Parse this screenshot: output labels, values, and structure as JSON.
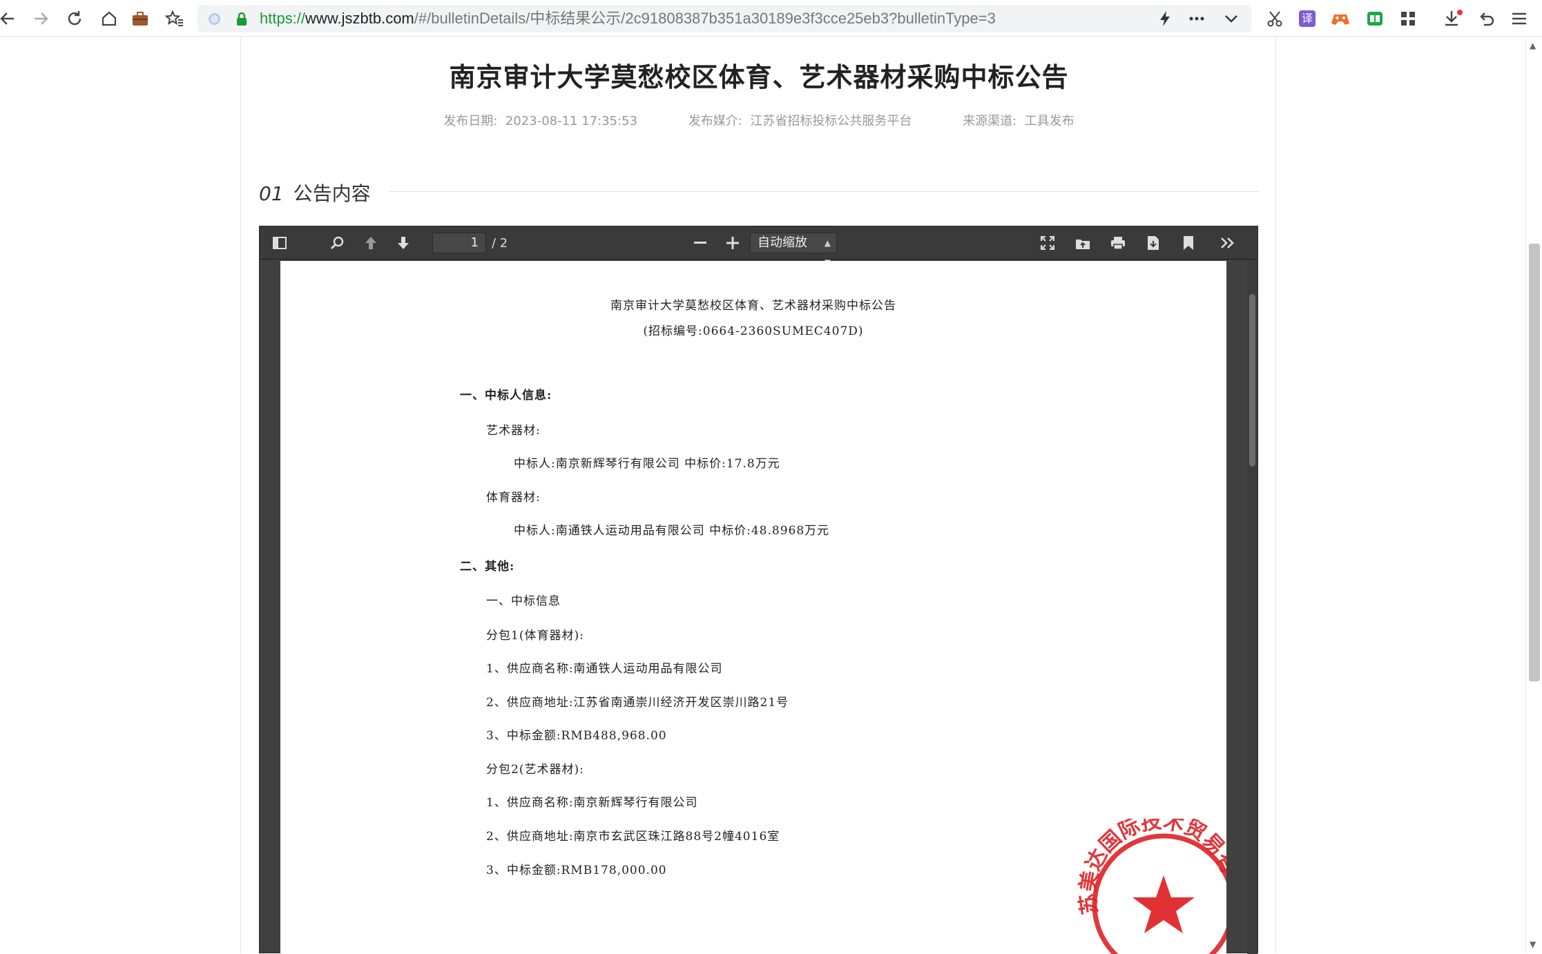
{
  "browser": {
    "url_protocol": "https://",
    "url_host": "www.jszbtb.com",
    "url_rest": "/#/bulletinDetails/中标结果公示/2c91808387b351a30189e3f3cce25eb3?bulletinType=3",
    "icons": [
      "back-icon",
      "forward-icon",
      "reload-icon",
      "home-icon",
      "briefcase-icon",
      "favorites-icon",
      "lightning-icon",
      "more-icon",
      "chevron-down-icon",
      "scissors-icon",
      "translate-icon",
      "gamepad-icon",
      "reader-icon",
      "apps-icon",
      "download-icon",
      "undo-icon",
      "menu-icon"
    ],
    "translate_glyph": "译",
    "accent": "#1a9a35"
  },
  "article": {
    "title": "南京审计大学莫愁校区体育、艺术器材采购中标公告",
    "publish_date_label": "发布日期:",
    "publish_date": "2023-08-11 17:35:53",
    "media_label": "发布媒介:",
    "media": "江苏省招标投标公共服务平台",
    "source_label": "来源渠道:",
    "source": "工具发布",
    "section_num": "01",
    "section_title": "公告内容"
  },
  "viewer": {
    "page_current": "1",
    "page_total": "/ 2",
    "zoom": "自动缩放"
  },
  "pdf": {
    "title": "南京审计大学莫愁校区体育、艺术器材采购中标公告",
    "bid_no": "(招标编号:0664-2360SUMEC407D)",
    "lines": [
      "一、中标人信息:",
      "艺术器材:",
      "中标人:南京新辉琴行有限公司 中标价:17.8万元",
      "体育器材:",
      "中标人:南通铁人运动用品有限公司 中标价:48.8968万元",
      "二、其他:",
      "一、中标信息",
      "分包1(体育器材):",
      "1、供应商名称:南通铁人运动用品有限公司",
      "2、供应商地址:江苏省南通崇川经济开发区崇川路21号",
      "3、中标金额:RMB488,968.00",
      "分包2(艺术器材):",
      "1、供应商名称:南京新辉琴行有限公司",
      "2、供应商地址:南京市玄武区珠江路88号2幢4016室",
      "3、中标金额:RMB178,000.00"
    ],
    "seal_text": "苏美达国际技术贸易有"
  }
}
